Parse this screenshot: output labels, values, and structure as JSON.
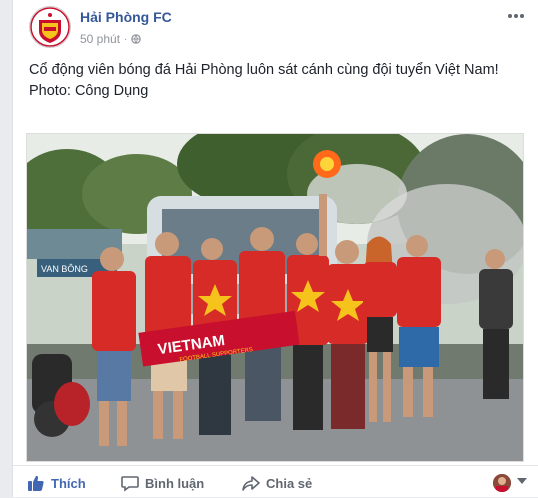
{
  "post": {
    "page_name": "Hải Phòng FC",
    "time": "50 phút",
    "separator": "·",
    "privacy_icon": "globe-icon",
    "more_icon": "more-horizontal-icon",
    "text_line1": "Cổ động viên bóng đá Hải Phòng luôn sát cánh cùng đội tuyển Việt Nam!",
    "text_line2": "Photo: Công Dụng",
    "photo": {
      "scarf_text": "VIETNAM",
      "scarf_subtext": "FOOTBALL SUPPORTERS",
      "bus_sign": "VAN BÔNG"
    }
  },
  "actions": {
    "like_label": "Thích",
    "comment_label": "Bình luận",
    "share_label": "Chia sẻ",
    "like_icon": "thumbs-up-icon",
    "comment_icon": "comment-bubble-icon",
    "share_icon": "share-arrow-icon"
  },
  "colors": {
    "link": "#365899",
    "like": "#4267b2",
    "jersey_red": "#d62b26",
    "meta": "#90949c"
  }
}
